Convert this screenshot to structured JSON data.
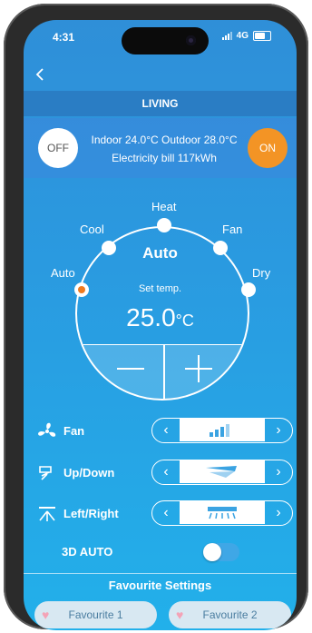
{
  "status": {
    "time": "4:31",
    "network": "4G"
  },
  "header": {
    "back_icon": "chevron-left-icon",
    "room_title": "LIVING"
  },
  "power": {
    "off_label": "OFF",
    "on_label": "ON"
  },
  "info": {
    "line1": "Indoor 24.0°C Outdoor 28.0°C",
    "line2": "Electricity bill 117kWh"
  },
  "modes": {
    "cool": "Cool",
    "heat": "Heat",
    "fan": "Fan",
    "auto": "Auto",
    "dry": "Dry",
    "selected": "Auto"
  },
  "temperature": {
    "current_mode": "Auto",
    "set_label": "Set temp.",
    "value": "25.0",
    "unit": "°C"
  },
  "controls": {
    "fan": {
      "label": "Fan",
      "level": 0.75
    },
    "updown": {
      "label": "Up/Down"
    },
    "leftright": {
      "label": "Left/Right"
    }
  },
  "auto3d": {
    "label": "3D AUTO",
    "enabled": false
  },
  "favourites": {
    "title": "Favourite Settings",
    "fav1": "Favourite 1",
    "fav2": "Favourite 2"
  },
  "colors": {
    "accent_on": "#f39425",
    "selected_dot": "#ef7a1f"
  }
}
